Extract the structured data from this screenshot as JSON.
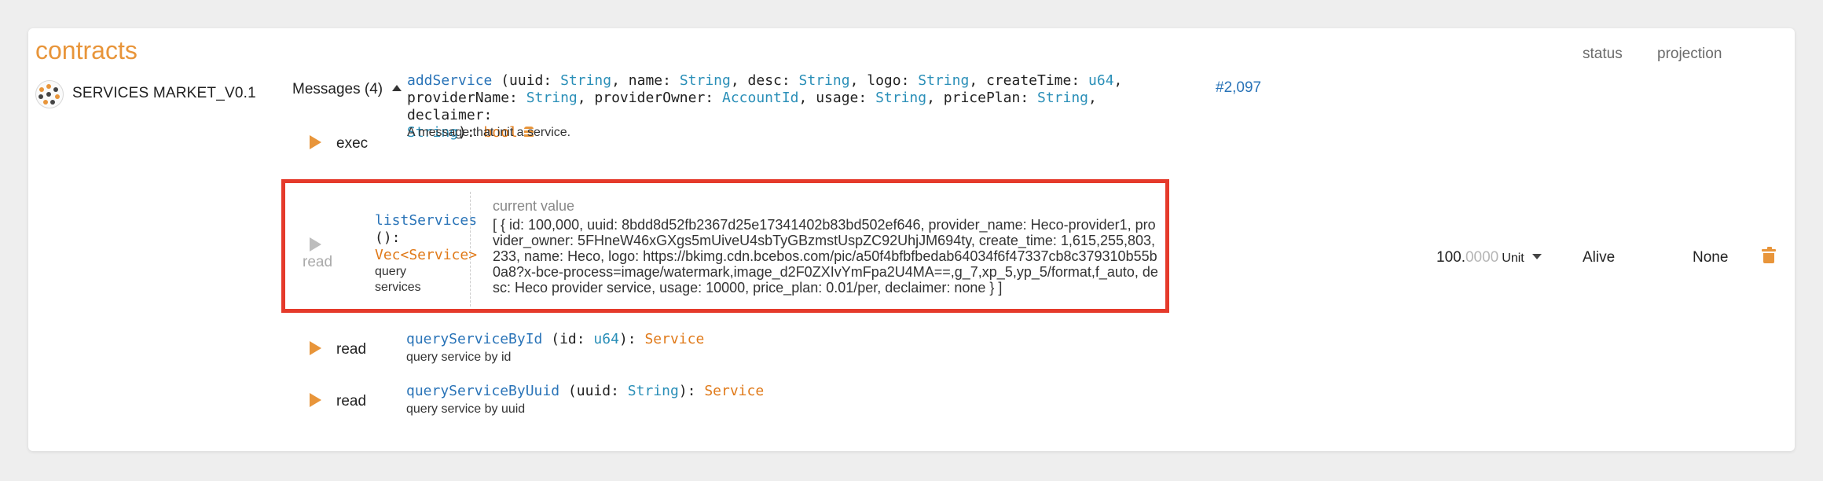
{
  "title": "contracts",
  "columns": {
    "status": "status",
    "projection": "projection"
  },
  "contract": {
    "icon": "contract-logo-icon",
    "name": "SERVICES MARKET_V0.1"
  },
  "messages_header": "Messages (4)",
  "code_hash": "#2,097",
  "messages": [
    {
      "kind": "exec",
      "lines": [
        [
          {
            "t": "addService",
            "c": "fn"
          },
          {
            "t": " (uuid: ",
            "c": ""
          },
          {
            "t": "String",
            "c": "ty-blue"
          },
          {
            "t": ", name: ",
            "c": ""
          },
          {
            "t": "String",
            "c": "ty-blue"
          },
          {
            "t": ", desc: ",
            "c": ""
          },
          {
            "t": "String",
            "c": "ty-blue"
          },
          {
            "t": ", logo: ",
            "c": ""
          },
          {
            "t": "String",
            "c": "ty-blue"
          },
          {
            "t": ", createTime: ",
            "c": ""
          },
          {
            "t": "u64",
            "c": "ty-blue"
          },
          {
            "t": ",",
            "c": ""
          }
        ],
        [
          {
            "t": "providerName: ",
            "c": ""
          },
          {
            "t": "String",
            "c": "ty-blue"
          },
          {
            "t": ", providerOwner: ",
            "c": ""
          },
          {
            "t": "AccountId",
            "c": "ty-blue"
          },
          {
            "t": ", usage: ",
            "c": ""
          },
          {
            "t": "String",
            "c": "ty-blue"
          },
          {
            "t": ", pricePlan: ",
            "c": ""
          },
          {
            "t": "String",
            "c": "ty-blue"
          },
          {
            "t": ", declaimer:",
            "c": ""
          }
        ],
        [
          {
            "t": "String",
            "c": "ty-blue"
          },
          {
            "t": "): ",
            "c": ""
          },
          {
            "t": "bool",
            "c": "ty-orange"
          }
        ]
      ],
      "desc": "A message that init a service."
    },
    {
      "kind": "read",
      "lines": [
        [
          {
            "t": "listServices",
            "c": "fn"
          }
        ],
        [
          {
            "t": "():",
            "c": ""
          }
        ],
        [
          {
            "t": "Vec<Service>",
            "c": "ty-orange"
          }
        ]
      ],
      "desc_lines": [
        "query",
        "services"
      ]
    },
    {
      "kind": "read",
      "lines": [
        [
          {
            "t": "queryServiceById",
            "c": "fn"
          },
          {
            "t": " (id: ",
            "c": ""
          },
          {
            "t": "u64",
            "c": "ty-blue"
          },
          {
            "t": "): ",
            "c": ""
          },
          {
            "t": "Service",
            "c": "ty-orange"
          }
        ]
      ],
      "desc": "query service by id"
    },
    {
      "kind": "read",
      "lines": [
        [
          {
            "t": "queryServiceByUuid",
            "c": "fn"
          },
          {
            "t": " (uuid: ",
            "c": ""
          },
          {
            "t": "String",
            "c": "ty-blue"
          },
          {
            "t": "): ",
            "c": ""
          },
          {
            "t": "Service",
            "c": "ty-orange"
          }
        ]
      ],
      "desc": "query service by uuid"
    }
  ],
  "current_value": {
    "label": "current value",
    "value": "[ { id: 100,000, uuid: 8bdd8d52fb2367d25e17341402b83bd502ef646, provider_name: Heco-provider1, provider_owner: 5FHneW46xGXgs5mUiveU4sbTyGBzmstUspZC92UhjJM694ty, create_time: 1,615,255,803,233, name: Heco, logo: https://bkimg.cdn.bcebos.com/pic/a50f4bfbfbedab64034f6f47337cb8c379310b55b0a8?x-bce-process=image/watermark,image_d2F0ZXIvYmFpa2U4MA==,g_7,xp_5,yp_5/format,f_auto, desc: Heco provider service, usage: 10000, price_plan: 0.01/per, declaimer: none } ]"
  },
  "balance": {
    "int": "100.",
    "dec": "0000",
    "unit": "Unit"
  },
  "status_value": "Alive",
  "projection_value": "None",
  "colors": {
    "accent": "#e8953a",
    "link": "#2a74b8",
    "highlight": "#e53a2b"
  }
}
